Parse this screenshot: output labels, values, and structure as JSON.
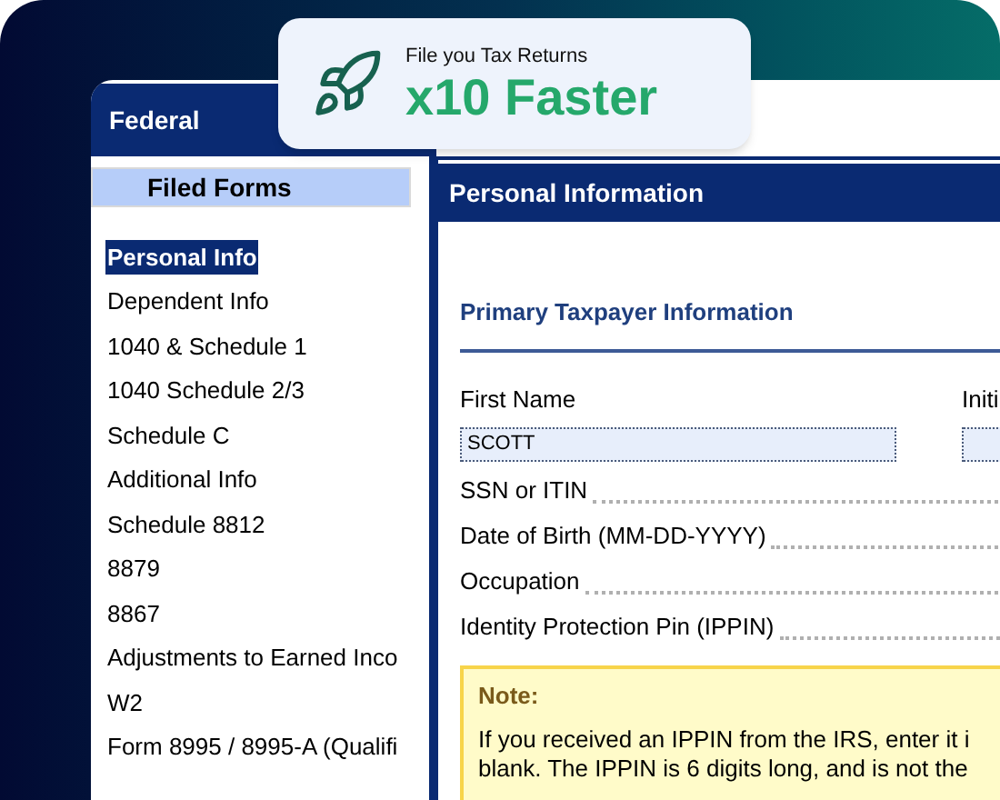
{
  "badge": {
    "caption": "File you Tax Returns",
    "headline": "x10 Faster"
  },
  "window": {
    "title": "Federal"
  },
  "sidebar": {
    "heading": "Filed Forms",
    "items": [
      {
        "label": "Personal Info",
        "selected": true
      },
      {
        "label": "Dependent Info",
        "selected": false
      },
      {
        "label": "1040 & Schedule 1",
        "selected": false
      },
      {
        "label": "1040 Schedule 2/3",
        "selected": false
      },
      {
        "label": "Schedule C",
        "selected": false
      },
      {
        "label": "Additional Info",
        "selected": false
      },
      {
        "label": "Schedule 8812",
        "selected": false
      },
      {
        "label": "8879",
        "selected": false
      },
      {
        "label": "8867",
        "selected": false
      },
      {
        "label": "Adjustments to Earned Inco",
        "selected": false
      },
      {
        "label": "W2",
        "selected": false
      },
      {
        "label": "Form 8995 / 8995-A (Qualifi",
        "selected": false
      }
    ]
  },
  "panel": {
    "title": "Personal Information",
    "section": "Primary Taxpayer Information",
    "name_fields": [
      {
        "label": "First Name",
        "value": "SCOTT"
      },
      {
        "label": "Initi"
      }
    ],
    "fields": [
      {
        "label": "SSN or ITIN"
      },
      {
        "label": "Date of Birth (MM-DD-YYYY)"
      },
      {
        "label": "Occupation"
      },
      {
        "label": "Identity Protection Pin (IPPIN)"
      }
    ],
    "note": {
      "title": "Note:",
      "lines": [
        "If you received an IPPIN from the IRS, enter it i",
        "blank. The IPPIN is 6 digits long, and is not the"
      ]
    }
  }
}
